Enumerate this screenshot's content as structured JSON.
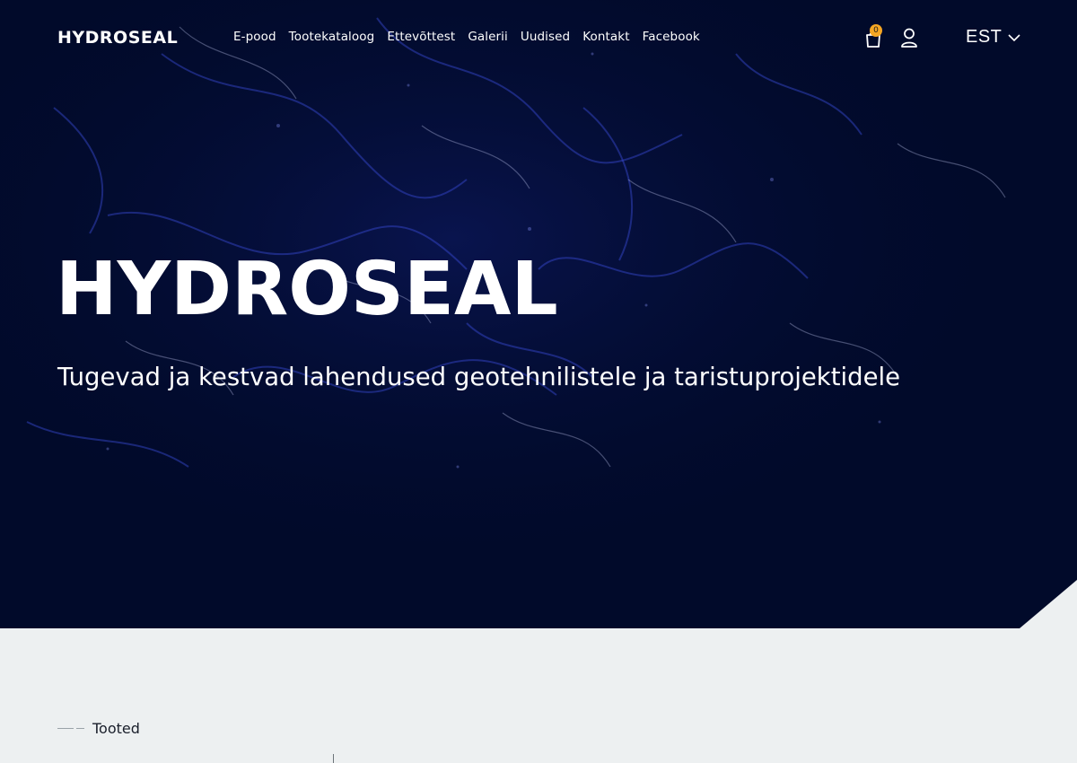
{
  "brand": {
    "logo_text": "HYDROSEAL"
  },
  "nav": {
    "items": [
      {
        "label": "E-pood"
      },
      {
        "label": "Tootekataloog"
      },
      {
        "label": "Ettevõttest"
      },
      {
        "label": "Galerii"
      },
      {
        "label": "Uudised"
      },
      {
        "label": "Kontakt"
      },
      {
        "label": "Facebook"
      }
    ]
  },
  "cart": {
    "count": "0",
    "icon": "cart-icon"
  },
  "account": {
    "icon": "user-icon"
  },
  "language": {
    "selected": "EST",
    "icon": "chevron-down-icon"
  },
  "hero": {
    "title": "HYDROSEAL",
    "subtitle": "Tugevad ja kestvad lahendused geotehnilistele ja taristuprojektidele"
  },
  "products_section": {
    "label": "Tooted"
  },
  "colors": {
    "hero_bg": "#010a2a",
    "section_bg": "#edf0f1",
    "badge": "#f5a623",
    "text_light": "#ffffff",
    "text_dark": "#1a1f2b"
  }
}
